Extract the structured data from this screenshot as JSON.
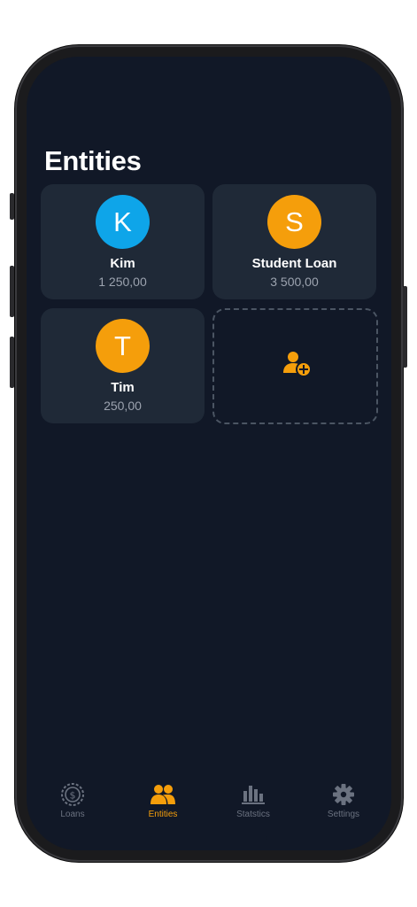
{
  "page": {
    "title": "Entities"
  },
  "entities": [
    {
      "initial": "K",
      "name": "Kim",
      "amount": "1 250,00",
      "color": "#0ea5e9"
    },
    {
      "initial": "S",
      "name": "Student Loan",
      "amount": "3 500,00",
      "color": "#f59e0b"
    },
    {
      "initial": "T",
      "name": "Tim",
      "amount": "250,00",
      "color": "#f59e0b"
    }
  ],
  "add_entity": {
    "icon": "person-add-icon"
  },
  "tabs": [
    {
      "label": "Loans",
      "icon": "dollar-coin-icon",
      "active": false
    },
    {
      "label": "Entities",
      "icon": "people-icon",
      "active": true
    },
    {
      "label": "Statstics",
      "icon": "bar-chart-icon",
      "active": false
    },
    {
      "label": "Settings",
      "icon": "gear-icon",
      "active": false
    }
  ],
  "colors": {
    "background": "#111827",
    "card": "#1f2937",
    "accent": "#f59e0b",
    "inactive": "#6b7280"
  }
}
